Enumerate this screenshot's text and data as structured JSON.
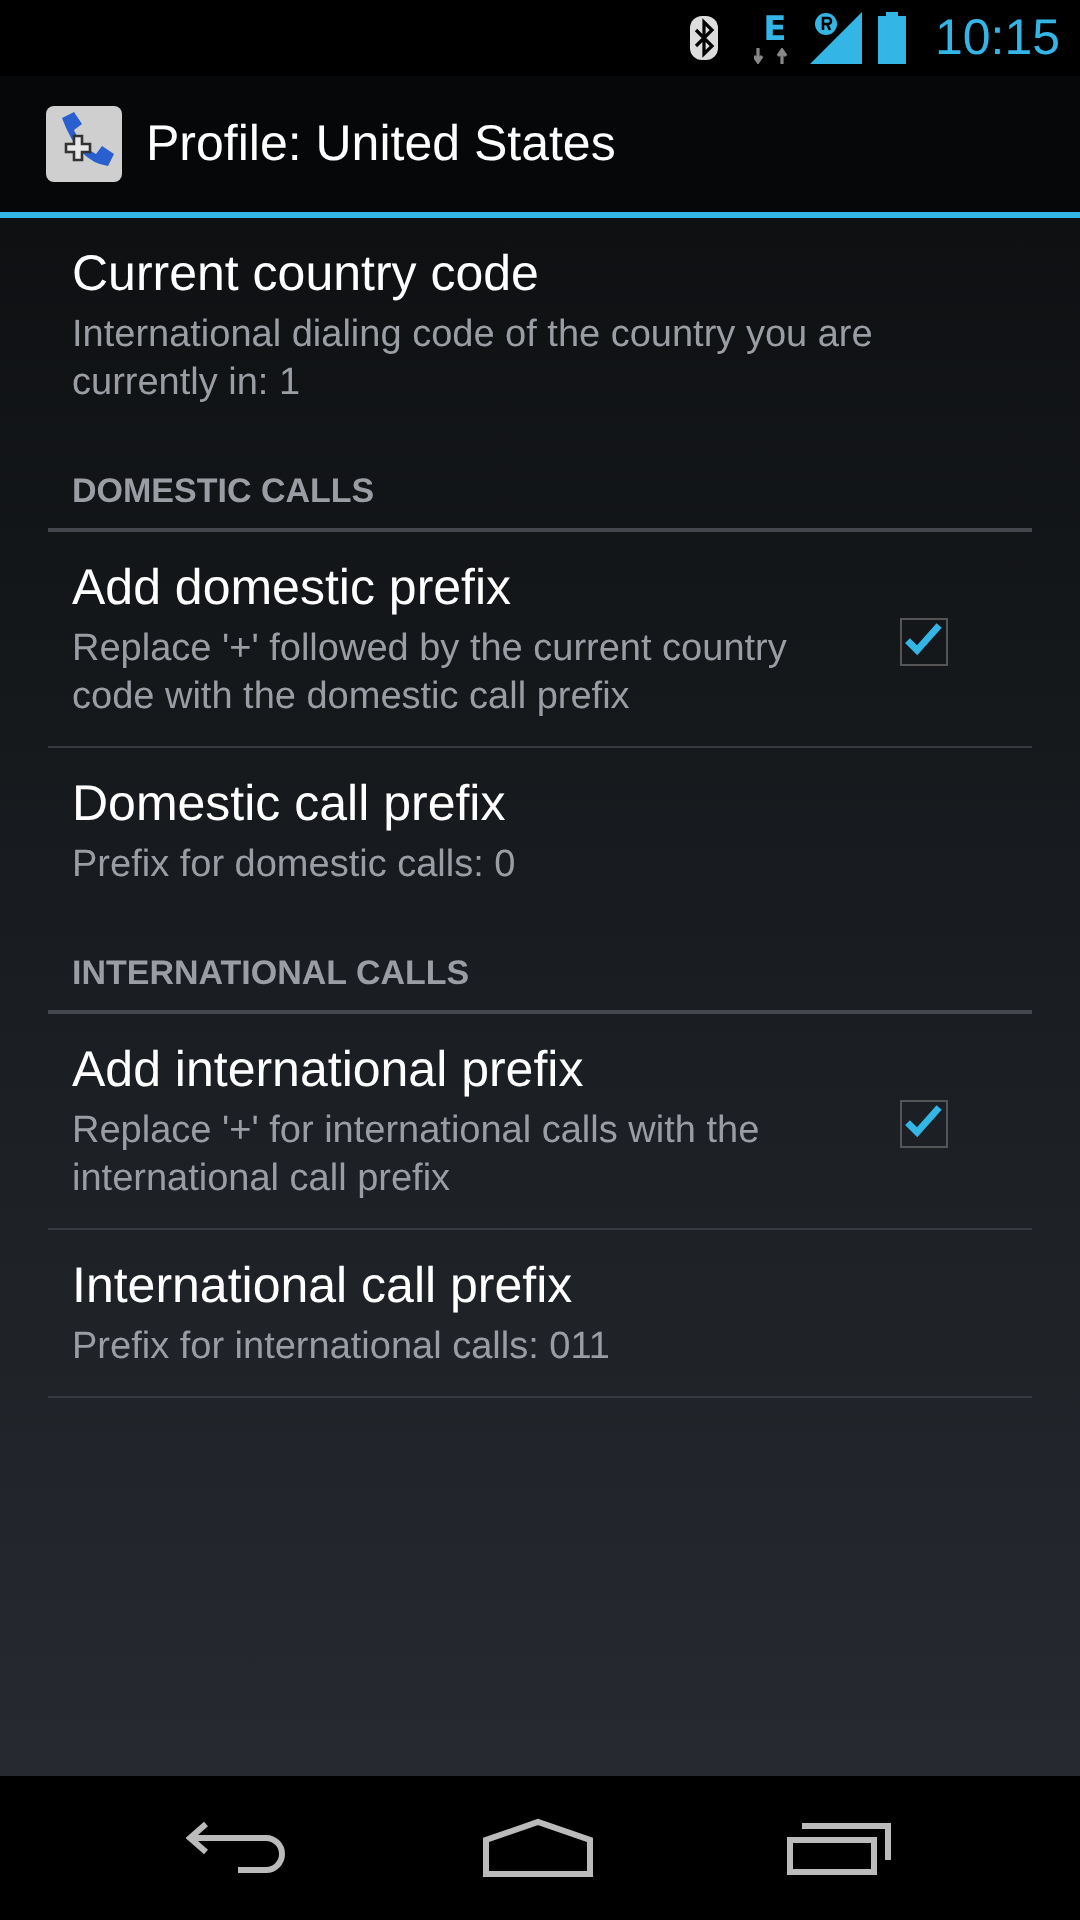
{
  "status_bar": {
    "network": "E",
    "time": "10:15"
  },
  "action_bar": {
    "title": "Profile: United States"
  },
  "items": [
    {
      "kind": "preference",
      "title": "Current country code",
      "summary": "International dialing code of the country you are currently in: 1"
    },
    {
      "kind": "category",
      "title": "DOMESTIC CALLS"
    },
    {
      "kind": "checkbox",
      "title": "Add domestic prefix",
      "summary": "Replace '+' followed by the current country code with the domestic call prefix",
      "checked": true
    },
    {
      "kind": "preference",
      "title": "Domestic call prefix",
      "summary": "Prefix for domestic calls: 0"
    },
    {
      "kind": "category",
      "title": "INTERNATIONAL CALLS"
    },
    {
      "kind": "checkbox",
      "title": "Add international prefix",
      "summary": "Replace '+' for international calls with the international call prefix",
      "checked": true
    },
    {
      "kind": "preference",
      "title": "International call prefix",
      "summary": "Prefix for international calls: 011"
    }
  ]
}
